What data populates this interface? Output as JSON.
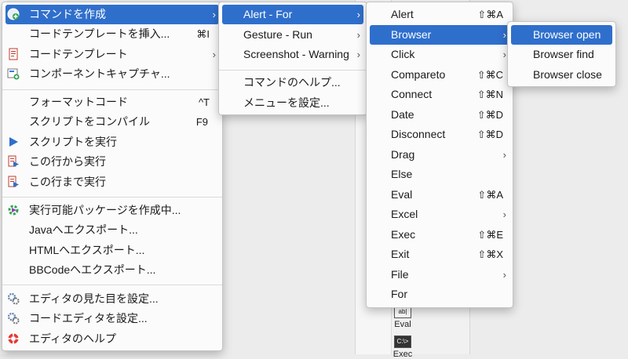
{
  "menu1": {
    "items": [
      {
        "label": "コマンドを作成",
        "shortcut": ""
      },
      {
        "label": "コードテンプレートを挿入...",
        "shortcut": "⌘I"
      },
      {
        "label": "コードテンプレート",
        "shortcut": ""
      },
      {
        "label": "コンポーネントキャプチャ...",
        "shortcut": ""
      },
      {
        "label": "フォーマットコード",
        "shortcut": "^T"
      },
      {
        "label": "スクリプトをコンパイル",
        "shortcut": "F9"
      },
      {
        "label": "スクリプトを実行",
        "shortcut": ""
      },
      {
        "label": "この行から実行",
        "shortcut": ""
      },
      {
        "label": "この行まで実行",
        "shortcut": ""
      },
      {
        "label": "実行可能パッケージを作成中...",
        "shortcut": ""
      },
      {
        "label": "Javaへエクスポート...",
        "shortcut": ""
      },
      {
        "label": "HTMLへエクスポート...",
        "shortcut": ""
      },
      {
        "label": "BBCodeへエクスポート...",
        "shortcut": ""
      },
      {
        "label": "エディタの見た目を設定...",
        "shortcut": ""
      },
      {
        "label": "コードエディタを設定...",
        "shortcut": ""
      },
      {
        "label": "エディタのヘルプ",
        "shortcut": ""
      }
    ]
  },
  "menu2": {
    "items": [
      {
        "label": "Alert - For"
      },
      {
        "label": "Gesture - Run"
      },
      {
        "label": "Screenshot - Warning"
      },
      {
        "label": "コマンドのヘルプ..."
      },
      {
        "label": "メニューを設定..."
      }
    ]
  },
  "menu3": {
    "items": [
      {
        "label": "Alert",
        "shortcut": "⇧⌘A"
      },
      {
        "label": "Browser",
        "shortcut": ""
      },
      {
        "label": "Click",
        "shortcut": ""
      },
      {
        "label": "Compareto",
        "shortcut": "⇧⌘C"
      },
      {
        "label": "Connect",
        "shortcut": "⇧⌘N"
      },
      {
        "label": "Date",
        "shortcut": "⇧⌘D"
      },
      {
        "label": "Disconnect",
        "shortcut": "⇧⌘D"
      },
      {
        "label": "Drag",
        "shortcut": ""
      },
      {
        "label": "Else",
        "shortcut": ""
      },
      {
        "label": "Eval",
        "shortcut": "⇧⌘A"
      },
      {
        "label": "Excel",
        "shortcut": ""
      },
      {
        "label": "Exec",
        "shortcut": "⇧⌘E"
      },
      {
        "label": "Exit",
        "shortcut": "⇧⌘X"
      },
      {
        "label": "File",
        "shortcut": ""
      },
      {
        "label": "For",
        "shortcut": ""
      }
    ]
  },
  "menu4": {
    "items": [
      {
        "label": "Browser open"
      },
      {
        "label": "Browser find"
      },
      {
        "label": "Browser close"
      }
    ]
  },
  "background": {
    "tool_eval": "Eval",
    "tool_exec": "Exec",
    "tool_eval_icon": "ab|",
    "tool_exec_icon": "C:\\>"
  }
}
